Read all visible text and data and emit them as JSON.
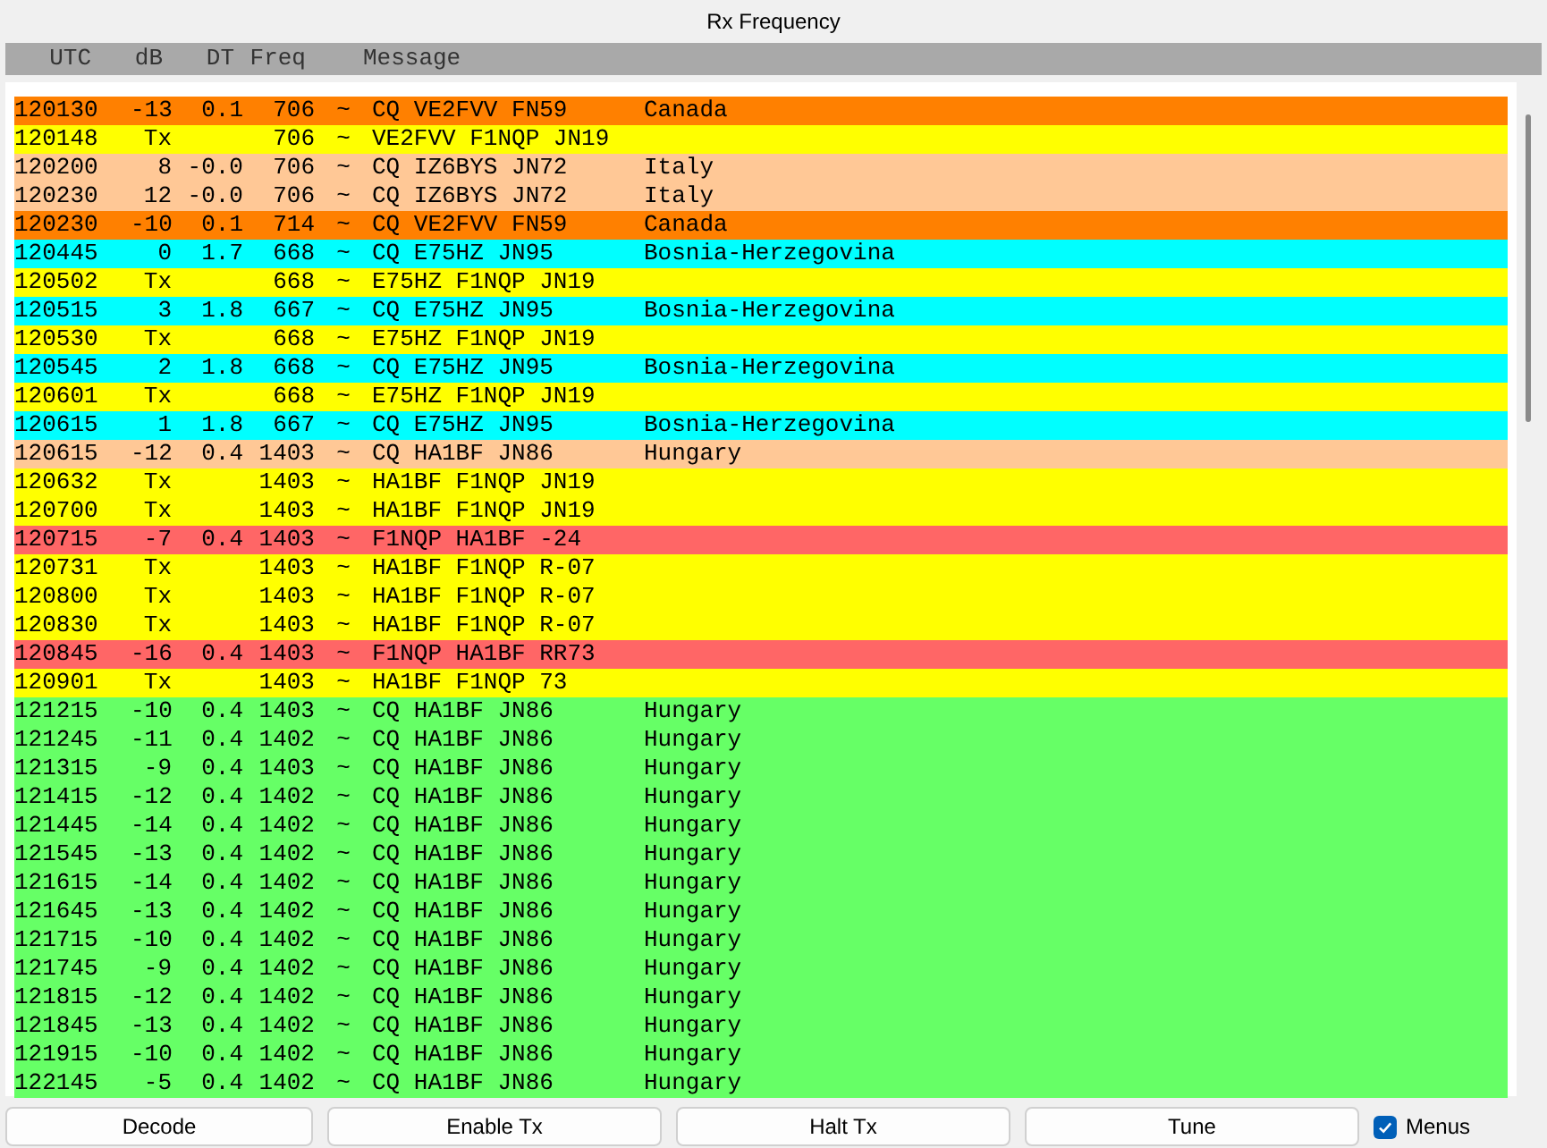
{
  "window": {
    "title": "Rx Frequency"
  },
  "table": {
    "columns": [
      "UTC",
      "dB",
      "DT",
      "Freq",
      "Message"
    ],
    "rows": [
      {
        "utc": "120130",
        "db": "-13",
        "dt": "0.1",
        "freq": "706",
        "mark": "~",
        "message": "CQ VE2FVV FN59",
        "country": "Canada",
        "color": "#ff8000"
      },
      {
        "utc": "120148",
        "db": "Tx",
        "freq": "706",
        "mark": "~",
        "message": "VE2FVV F1NQP JN19",
        "color": "#ffff00"
      },
      {
        "utc": "120200",
        "db": "8",
        "dt": "-0.0",
        "freq": "706",
        "mark": "~",
        "message": "CQ IZ6BYS JN72",
        "country": "Italy",
        "color": "#ffc896"
      },
      {
        "utc": "120230",
        "db": "12",
        "dt": "-0.0",
        "freq": "706",
        "mark": "~",
        "message": "CQ IZ6BYS JN72",
        "country": "Italy",
        "color": "#ffc896"
      },
      {
        "utc": "120230",
        "db": "-10",
        "dt": "0.1",
        "freq": "714",
        "mark": "~",
        "message": "CQ VE2FVV FN59",
        "country": "Canada",
        "color": "#ff8000"
      },
      {
        "utc": "120445",
        "db": "0",
        "dt": "1.7",
        "freq": "668",
        "mark": "~",
        "message": "CQ E75HZ JN95",
        "country": "Bosnia-Herzegovina",
        "color": "#00ffff"
      },
      {
        "utc": "120502",
        "db": "Tx",
        "freq": "668",
        "mark": "~",
        "message": "E75HZ F1NQP JN19",
        "color": "#ffff00"
      },
      {
        "utc": "120515",
        "db": "3",
        "dt": "1.8",
        "freq": "667",
        "mark": "~",
        "message": "CQ E75HZ JN95",
        "country": "Bosnia-Herzegovina",
        "color": "#00ffff"
      },
      {
        "utc": "120530",
        "db": "Tx",
        "freq": "668",
        "mark": "~",
        "message": "E75HZ F1NQP JN19",
        "color": "#ffff00"
      },
      {
        "utc": "120545",
        "db": "2",
        "dt": "1.8",
        "freq": "668",
        "mark": "~",
        "message": "CQ E75HZ JN95",
        "country": "Bosnia-Herzegovina",
        "color": "#00ffff"
      },
      {
        "utc": "120601",
        "db": "Tx",
        "freq": "668",
        "mark": "~",
        "message": "E75HZ F1NQP JN19",
        "color": "#ffff00"
      },
      {
        "utc": "120615",
        "db": "1",
        "dt": "1.8",
        "freq": "667",
        "mark": "~",
        "message": "CQ E75HZ JN95",
        "country": "Bosnia-Herzegovina",
        "color": "#00ffff"
      },
      {
        "utc": "120615",
        "db": "-12",
        "dt": "0.4",
        "freq": "1403",
        "mark": "~",
        "message": "CQ HA1BF JN86",
        "country": "Hungary",
        "color": "#ffc896"
      },
      {
        "utc": "120632",
        "db": "Tx",
        "freq": "1403",
        "mark": "~",
        "message": "HA1BF F1NQP JN19",
        "color": "#ffff00"
      },
      {
        "utc": "120700",
        "db": "Tx",
        "freq": "1403",
        "mark": "~",
        "message": "HA1BF F1NQP JN19",
        "color": "#ffff00"
      },
      {
        "utc": "120715",
        "db": "-7",
        "dt": "0.4",
        "freq": "1403",
        "mark": "~",
        "message": "F1NQP HA1BF -24",
        "color": "#ff6666"
      },
      {
        "utc": "120731",
        "db": "Tx",
        "freq": "1403",
        "mark": "~",
        "message": "HA1BF F1NQP R-07",
        "color": "#ffff00"
      },
      {
        "utc": "120800",
        "db": "Tx",
        "freq": "1403",
        "mark": "~",
        "message": "HA1BF F1NQP R-07",
        "color": "#ffff00"
      },
      {
        "utc": "120830",
        "db": "Tx",
        "freq": "1403",
        "mark": "~",
        "message": "HA1BF F1NQP R-07",
        "color": "#ffff00"
      },
      {
        "utc": "120845",
        "db": "-16",
        "dt": "0.4",
        "freq": "1403",
        "mark": "~",
        "message": "F1NQP HA1BF RR73",
        "color": "#ff6666"
      },
      {
        "utc": "120901",
        "db": "Tx",
        "freq": "1403",
        "mark": "~",
        "message": "HA1BF F1NQP 73",
        "color": "#ffff00"
      },
      {
        "utc": "121215",
        "db": "-10",
        "dt": "0.4",
        "freq": "1403",
        "mark": "~",
        "message": "CQ HA1BF JN86",
        "country": "Hungary",
        "color": "#66ff66"
      },
      {
        "utc": "121245",
        "db": "-11",
        "dt": "0.4",
        "freq": "1402",
        "mark": "~",
        "message": "CQ HA1BF JN86",
        "country": "Hungary",
        "color": "#66ff66"
      },
      {
        "utc": "121315",
        "db": "-9",
        "dt": "0.4",
        "freq": "1403",
        "mark": "~",
        "message": "CQ HA1BF JN86",
        "country": "Hungary",
        "color": "#66ff66"
      },
      {
        "utc": "121415",
        "db": "-12",
        "dt": "0.4",
        "freq": "1402",
        "mark": "~",
        "message": "CQ HA1BF JN86",
        "country": "Hungary",
        "color": "#66ff66"
      },
      {
        "utc": "121445",
        "db": "-14",
        "dt": "0.4",
        "freq": "1402",
        "mark": "~",
        "message": "CQ HA1BF JN86",
        "country": "Hungary",
        "color": "#66ff66"
      },
      {
        "utc": "121545",
        "db": "-13",
        "dt": "0.4",
        "freq": "1402",
        "mark": "~",
        "message": "CQ HA1BF JN86",
        "country": "Hungary",
        "color": "#66ff66"
      },
      {
        "utc": "121615",
        "db": "-14",
        "dt": "0.4",
        "freq": "1402",
        "mark": "~",
        "message": "CQ HA1BF JN86",
        "country": "Hungary",
        "color": "#66ff66"
      },
      {
        "utc": "121645",
        "db": "-13",
        "dt": "0.4",
        "freq": "1402",
        "mark": "~",
        "message": "CQ HA1BF JN86",
        "country": "Hungary",
        "color": "#66ff66"
      },
      {
        "utc": "121715",
        "db": "-10",
        "dt": "0.4",
        "freq": "1402",
        "mark": "~",
        "message": "CQ HA1BF JN86",
        "country": "Hungary",
        "color": "#66ff66"
      },
      {
        "utc": "121745",
        "db": "-9",
        "dt": "0.4",
        "freq": "1402",
        "mark": "~",
        "message": "CQ HA1BF JN86",
        "country": "Hungary",
        "color": "#66ff66"
      },
      {
        "utc": "121815",
        "db": "-12",
        "dt": "0.4",
        "freq": "1402",
        "mark": "~",
        "message": "CQ HA1BF JN86",
        "country": "Hungary",
        "color": "#66ff66"
      },
      {
        "utc": "121845",
        "db": "-13",
        "dt": "0.4",
        "freq": "1402",
        "mark": "~",
        "message": "CQ HA1BF JN86",
        "country": "Hungary",
        "color": "#66ff66"
      },
      {
        "utc": "121915",
        "db": "-10",
        "dt": "0.4",
        "freq": "1402",
        "mark": "~",
        "message": "CQ HA1BF JN86",
        "country": "Hungary",
        "color": "#66ff66"
      },
      {
        "utc": "122145",
        "db": "-5",
        "dt": "0.4",
        "freq": "1402",
        "mark": "~",
        "message": "CQ HA1BF JN86",
        "country": "Hungary",
        "color": "#66ff66"
      }
    ]
  },
  "buttons": [
    "Decode",
    "Enable Tx",
    "Halt Tx",
    "Tune"
  ],
  "menus_checkbox": {
    "label": "Menus",
    "checked": true
  }
}
